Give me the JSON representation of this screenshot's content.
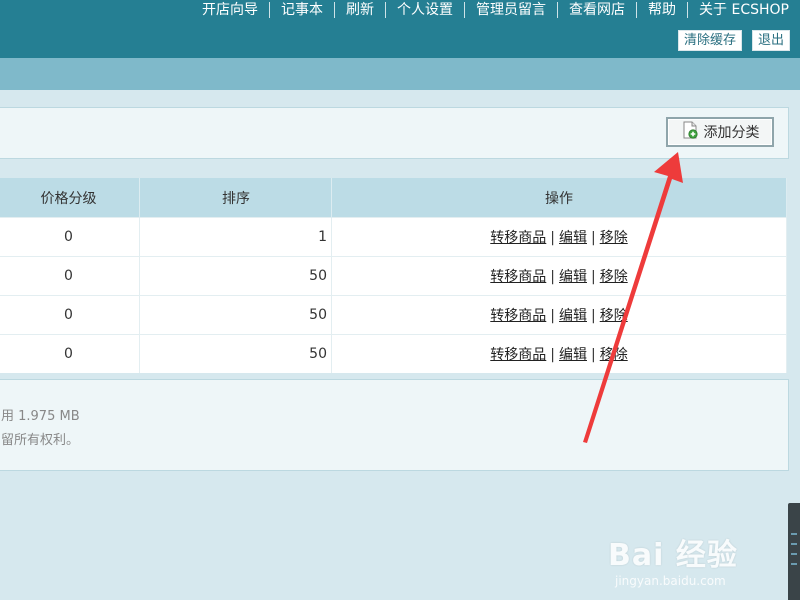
{
  "header": {
    "nav": [
      "开店向导",
      "记事本",
      "刷新",
      "个人设置",
      "管理员留言",
      "查看网店",
      "帮助",
      "关于 ECSHOP"
    ],
    "actions": {
      "clear_cache": "清除缓存",
      "logout": "退出"
    }
  },
  "toolbar": {
    "add_category": "添加分类",
    "add_icon": "add-category-icon"
  },
  "table": {
    "columns": [
      "价格分级",
      "排序",
      "操作"
    ],
    "rows": [
      {
        "price_grade": "0",
        "sort": "1"
      },
      {
        "price_grade": "0",
        "sort": "50"
      },
      {
        "price_grade": "0",
        "sort": "50"
      },
      {
        "price_grade": "0",
        "sort": "50"
      }
    ],
    "row_actions": {
      "transfer": "转移商品",
      "edit": "编辑",
      "remove": "移除",
      "separator": "|"
    }
  },
  "footer": {
    "line1": "用 1.975 MB",
    "line2": "留所有权利。"
  },
  "watermark": {
    "brand": "Bai 经验",
    "url": "jingyan.baidu.com"
  },
  "colors": {
    "header_bg": "#257f93",
    "subbar_bg": "#7fb9ca",
    "table_header_bg": "#bcdce6",
    "arrow": "#ee3b3b"
  }
}
